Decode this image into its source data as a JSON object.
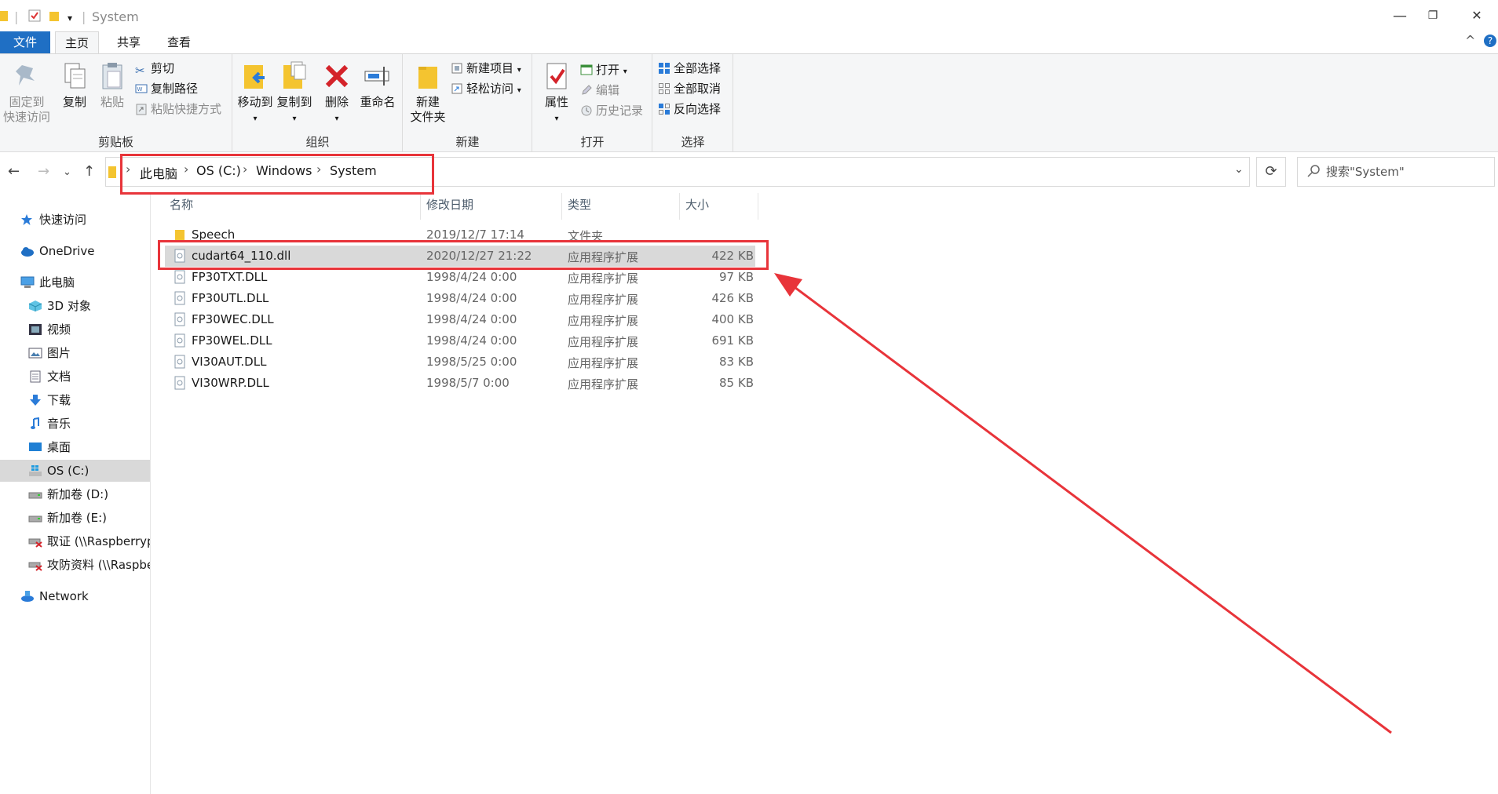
{
  "window": {
    "title": "System",
    "minimize": "—",
    "restore": "❐",
    "close": "✕",
    "help": "?",
    "collapse": "^"
  },
  "tabs": [
    {
      "label": "文件"
    },
    {
      "label": "主页"
    },
    {
      "label": "共享"
    },
    {
      "label": "查看"
    }
  ],
  "ribbon": {
    "clipboard": {
      "group_label": "剪贴板",
      "pin": "固定到\n快速访问",
      "copy": "复制",
      "paste": "粘贴",
      "cut": "剪切",
      "copy_path": "复制路径",
      "paste_shortcut": "粘贴快捷方式"
    },
    "organize": {
      "group_label": "组织",
      "move_to": "移动到",
      "copy_to": "复制到",
      "delete": "删除",
      "rename": "重命名"
    },
    "new": {
      "group_label": "新建",
      "new_folder": "新建\n文件夹",
      "new_item": "新建项目",
      "easy_access": "轻松访问"
    },
    "open": {
      "group_label": "打开",
      "properties": "属性",
      "open": "打开",
      "edit": "编辑",
      "history": "历史记录"
    },
    "select": {
      "group_label": "选择",
      "select_all": "全部选择",
      "select_none": "全部取消",
      "invert": "反向选择"
    }
  },
  "address": {
    "crumbs": [
      "此电脑",
      "OS (C:)",
      "Windows",
      "System"
    ],
    "search_placeholder": "搜索\"System\""
  },
  "nav": [
    {
      "label": "快速访问",
      "icon": "star-icon"
    },
    {
      "label": "OneDrive",
      "icon": "cloud-icon"
    },
    {
      "label": "此电脑",
      "icon": "computer-icon"
    },
    {
      "label": "3D 对象",
      "icon": "cube-icon"
    },
    {
      "label": "视频",
      "icon": "video-icon"
    },
    {
      "label": "图片",
      "icon": "picture-icon"
    },
    {
      "label": "文档",
      "icon": "document-icon"
    },
    {
      "label": "下载",
      "icon": "download-icon"
    },
    {
      "label": "音乐",
      "icon": "music-icon"
    },
    {
      "label": "桌面",
      "icon": "desktop-icon"
    },
    {
      "label": "OS (C:)",
      "icon": "windows-drive-icon"
    },
    {
      "label": "新加卷 (D:)",
      "icon": "drive-icon"
    },
    {
      "label": "新加卷 (E:)",
      "icon": "drive-icon"
    },
    {
      "label": "取证 (\\\\Raspberryp",
      "icon": "network-drive-disconnected-icon"
    },
    {
      "label": "攻防资料 (\\\\Raspbe",
      "icon": "network-drive-disconnected-icon"
    },
    {
      "label": "Network",
      "icon": "network-icon"
    }
  ],
  "columns": {
    "name": "名称",
    "date": "修改日期",
    "type": "类型",
    "size": "大小"
  },
  "files": [
    {
      "name": "Speech",
      "date": "2019/12/7 17:14",
      "type": "文件夹",
      "size": "",
      "kind": "folder"
    },
    {
      "name": "cudart64_110.dll",
      "date": "2020/12/27 21:22",
      "type": "应用程序扩展",
      "size": "422 KB",
      "kind": "dll"
    },
    {
      "name": "FP30TXT.DLL",
      "date": "1998/4/24 0:00",
      "type": "应用程序扩展",
      "size": "97 KB",
      "kind": "dll"
    },
    {
      "name": "FP30UTL.DLL",
      "date": "1998/4/24 0:00",
      "type": "应用程序扩展",
      "size": "426 KB",
      "kind": "dll"
    },
    {
      "name": "FP30WEC.DLL",
      "date": "1998/4/24 0:00",
      "type": "应用程序扩展",
      "size": "400 KB",
      "kind": "dll"
    },
    {
      "name": "FP30WEL.DLL",
      "date": "1998/4/24 0:00",
      "type": "应用程序扩展",
      "size": "691 KB",
      "kind": "dll"
    },
    {
      "name": "VI30AUT.DLL",
      "date": "1998/5/25 0:00",
      "type": "应用程序扩展",
      "size": "83 KB",
      "kind": "dll"
    },
    {
      "name": "VI30WRP.DLL",
      "date": "1998/5/7 0:00",
      "type": "应用程序扩展",
      "size": "85 KB",
      "kind": "dll"
    }
  ],
  "colors": {
    "accent": "#1f6fc4",
    "annotation": "#e8343a",
    "selection": "#d9d9d9"
  }
}
